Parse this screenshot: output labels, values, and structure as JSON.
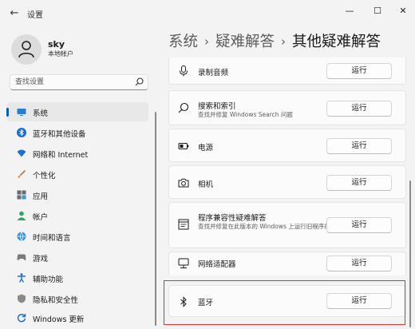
{
  "app": {
    "title": "设置",
    "back_icon": "back-arrow-icon"
  },
  "window_controls": {
    "minimize": "—",
    "maximize": "☐",
    "close": "✕"
  },
  "user": {
    "name": "sky",
    "account_type": "本地帐户"
  },
  "search": {
    "placeholder": "查找设置"
  },
  "sidebar": {
    "items": [
      {
        "label": "系统",
        "icon": "system-icon",
        "selected": true
      },
      {
        "label": "蓝牙和其他设备",
        "icon": "bluetooth-icon"
      },
      {
        "label": "网络和 Internet",
        "icon": "wifi-icon"
      },
      {
        "label": "个性化",
        "icon": "brush-icon"
      },
      {
        "label": "应用",
        "icon": "apps-icon"
      },
      {
        "label": "帐户",
        "icon": "account-icon"
      },
      {
        "label": "时间和语言",
        "icon": "globe-icon"
      },
      {
        "label": "游戏",
        "icon": "game-icon"
      },
      {
        "label": "辅助功能",
        "icon": "accessibility-icon"
      },
      {
        "label": "隐私和安全性",
        "icon": "shield-icon"
      },
      {
        "label": "Windows 更新",
        "icon": "update-icon"
      }
    ]
  },
  "breadcrumb": {
    "part1": "系统",
    "part2": "疑难解答",
    "current": "其他疑难解答",
    "separator": "›"
  },
  "troubleshooters": [
    {
      "title": "录制音频",
      "icon": "microphone-icon",
      "button": "运行"
    },
    {
      "title": "搜索和索引",
      "description": "查找并修复 Windows Search 问题",
      "icon": "search-icon",
      "button": "运行"
    },
    {
      "title": "电源",
      "icon": "battery-icon",
      "button": "运行"
    },
    {
      "title": "相机",
      "icon": "camera-icon",
      "button": "运行"
    },
    {
      "title": "程序兼容性疑难解答",
      "description": "查找并修复在此版本的 Windows 上运行旧程序的问题",
      "icon": "compatibility-icon",
      "button": "运行"
    },
    {
      "title": "网络适配器",
      "icon": "network-adapter-icon",
      "button": "运行"
    },
    {
      "title": "蓝牙",
      "icon": "bluetooth-icon",
      "button": "运行"
    }
  ],
  "colors": {
    "accent": "#005fb8",
    "highlight_box": "#e03131",
    "background": "#f3f3f3",
    "card": "#fbfbfb"
  }
}
